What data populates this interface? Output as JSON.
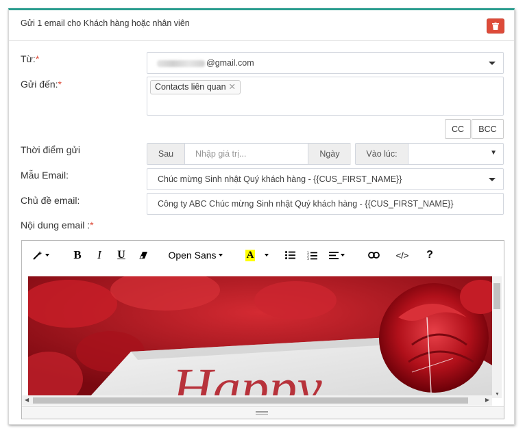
{
  "panel": {
    "title": "Gửi 1 email cho Khách hàng hoặc nhân viên"
  },
  "form": {
    "from_label": "Từ:",
    "from_value_suffix": "@gmail.com",
    "to_label": "Gửi đến:",
    "to_tag": "Contacts liên quan",
    "cc_label": "CC",
    "bcc_label": "BCC",
    "time_label": "Thời điểm gửi",
    "after_label": "Sau",
    "input_placeholder": "Nhập giá trị...",
    "day_label": "Ngày",
    "at_label": "Vào lúc:",
    "template_label": "Mẫu Email:",
    "template_value": "Chúc mừng Sinh nhật Quý khách hàng - {{CUS_FIRST_NAME}}",
    "subject_label": "Chủ đề email:",
    "subject_value": "Công ty ABC Chúc mừng Sinh nhật Quý khách hàng - {{CUS_FIRST_NAME}}",
    "body_label": "Nội dung email :",
    "required_mark": "*"
  },
  "editor": {
    "font_name": "Open Sans",
    "help": "?",
    "code": "</>"
  },
  "colors": {
    "accent": "#2a9d8f",
    "danger": "#dd4b39",
    "highlight": "#ffff00"
  }
}
